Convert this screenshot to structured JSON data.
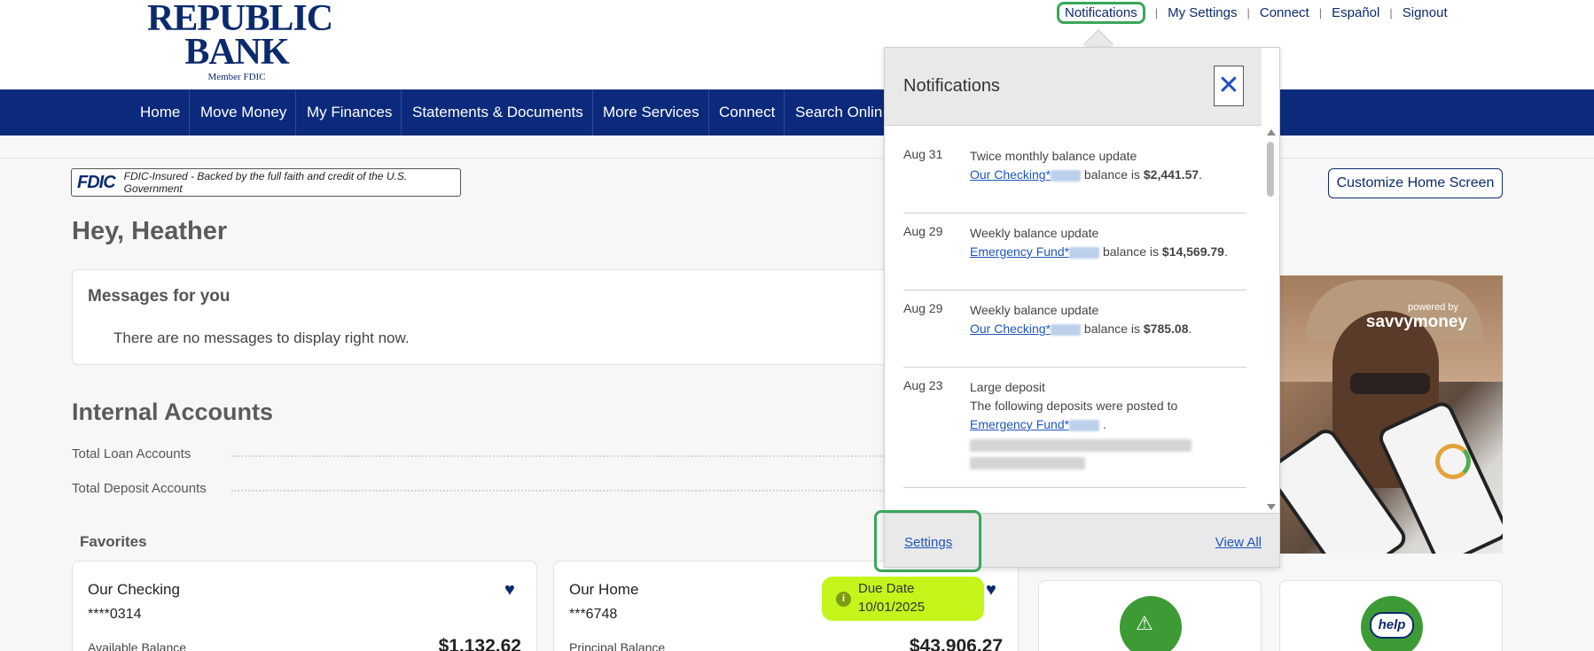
{
  "logo": {
    "line1": "REPUBLIC",
    "line2": "BANK",
    "member": "Member FDIC"
  },
  "utility_nav": {
    "notifications": "Notifications",
    "my_settings": "My Settings",
    "connect": "Connect",
    "espanol": "Español",
    "signout": "Signout",
    "separator": "|"
  },
  "main_nav": [
    "Home",
    "Move Money",
    "My Finances",
    "Statements & Documents",
    "More Services",
    "Connect",
    "Search Onlin"
  ],
  "fdic": {
    "mark": "FDIC",
    "text": "FDIC-Insured - Backed by the full faith and credit of the U.S. Government"
  },
  "customize_button": "Customize Home Screen",
  "greeting": "Hey, Heather",
  "messages": {
    "title": "Messages for you",
    "empty": "There are no messages to display right now."
  },
  "internal_accounts": {
    "title": "Internal Accounts",
    "rows": [
      "Total Loan Accounts",
      "Total Deposit Accounts"
    ]
  },
  "favorites": {
    "title": "Favorites",
    "accounts": [
      {
        "name": "Our Checking",
        "number": "****0314",
        "balance_label": "Available Balance",
        "balance": "$1,132.62"
      },
      {
        "name": "Our Home",
        "number": "***6748",
        "balance_label": "Principal Balance",
        "balance": "$43,906.27"
      }
    ],
    "due": {
      "label": "Due Date",
      "date": "10/01/2025"
    }
  },
  "promo": {
    "powered_by": "powered by",
    "brand": "savvymoney"
  },
  "tiles": {
    "help": "help"
  },
  "notifications_popup": {
    "title": "Notifications",
    "close_symbol": "✕",
    "items": [
      {
        "date": "Aug 31",
        "headline": "Twice monthly balance update",
        "account": "Our Checking*",
        "middle": " balance is ",
        "amount": "$2,441.57",
        "end": "."
      },
      {
        "date": "Aug 29",
        "headline": "Weekly balance update",
        "account": "Emergency Fund*",
        "middle": " balance is ",
        "amount": "$14,569.79",
        "end": "."
      },
      {
        "date": "Aug 29",
        "headline": "Weekly balance update",
        "account": "Our Checking*",
        "middle": " balance is ",
        "amount": "$785.08",
        "end": "."
      },
      {
        "date": "Aug 23",
        "headline": "Large deposit",
        "subline": "The following deposits were posted to",
        "account": "Emergency Fund*",
        "end": " ."
      }
    ],
    "footer": {
      "settings": "Settings",
      "view_all": "View All"
    }
  },
  "colors": {
    "brand_navy": "#0b2a7b",
    "highlight_green": "#3aa65a",
    "due_lime": "#c3f51a",
    "link_blue": "#1e55c0"
  }
}
